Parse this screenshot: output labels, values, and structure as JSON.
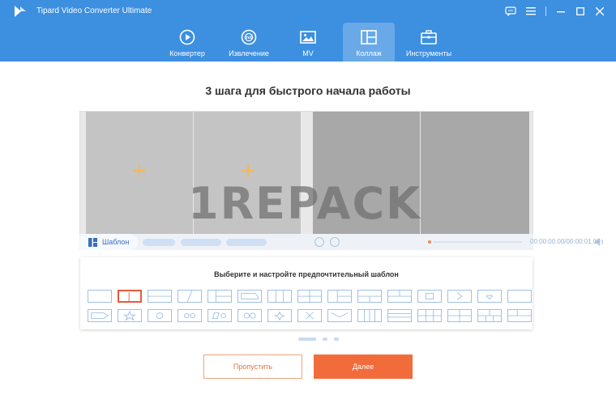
{
  "app": {
    "title": "Tipard Video Converter Ultimate"
  },
  "nav": {
    "tabs": [
      {
        "label": "Конвертер",
        "icon": "converter-icon"
      },
      {
        "label": "Извлечение",
        "icon": "dvd-rip-icon"
      },
      {
        "label": "MV",
        "icon": "mv-image-icon"
      },
      {
        "label": "Коллаж",
        "icon": "collage-icon",
        "active": true
      },
      {
        "label": "Инструменты",
        "icon": "toolbox-icon"
      }
    ]
  },
  "main": {
    "title": "3 шага для быстрого начала работы",
    "watermark": "1REPACK",
    "template_tab": "Шаблон",
    "time": "00:00:00.00/00:00:01.00",
    "template_panel_title": "Выберите и настройте предпочтительный шаблон",
    "skip_button": "Пропустить",
    "next_button": "Далее"
  },
  "colors": {
    "header": "#3d8fe0",
    "accent": "#f26b3a"
  }
}
